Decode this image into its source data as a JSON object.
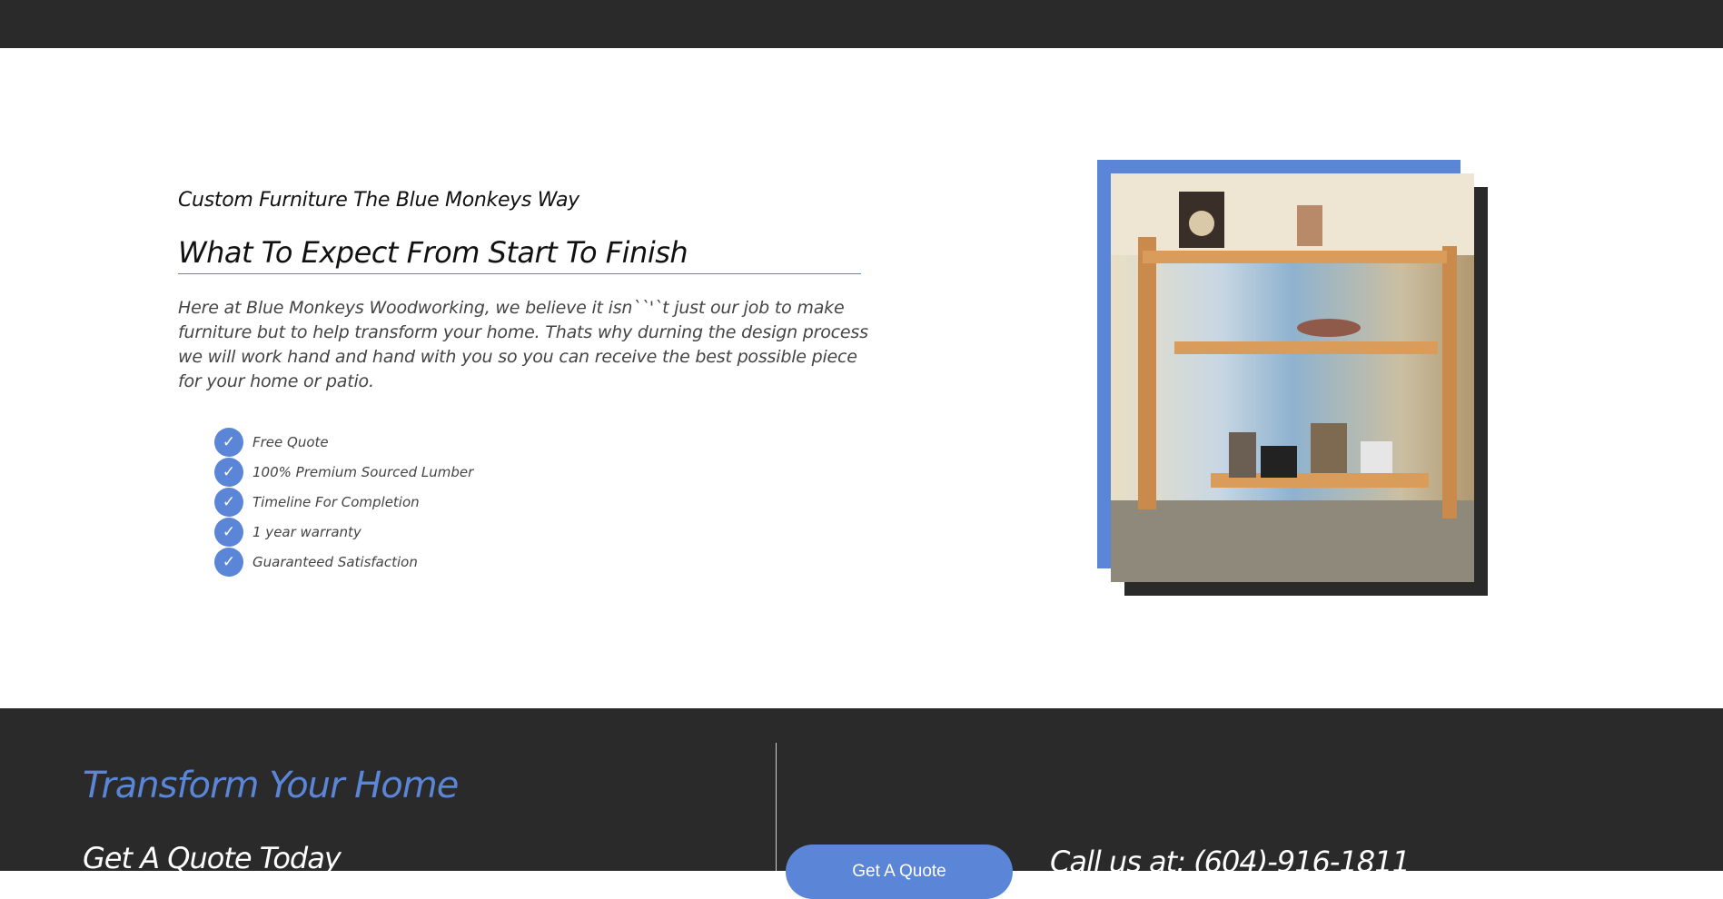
{
  "intro": {
    "eyebrow": "Custom Furniture The Blue Monkeys Way",
    "heading": "What To Expect From Start To Finish",
    "body": "Here at Blue Monkeys Woodworking, we believe it isn``'`t just our job to make furniture but to help transform your home. Thats why durning the design process we will work hand and hand with you so you can receive the best possible piece for your home or patio."
  },
  "features": {
    "icon": "check-icon",
    "check_glyph": "✓",
    "items": [
      "Free Quote",
      "100% Premium Sourced Lumber",
      "Timeline For Completion",
      "1 year warranty",
      "Guaranteed Satisfaction"
    ]
  },
  "photo": {
    "subject": "Wooden shelf unit with shoes and decor"
  },
  "footer": {
    "title": "Transform Your Home",
    "subtitle": "Get A Quote Today",
    "button_label": "Get A Quote",
    "phone_text": "Call us at: (604)-916-1811"
  },
  "colors": {
    "accent": "#5b86d8",
    "dark": "#2a2a2a",
    "text": "#444444"
  }
}
